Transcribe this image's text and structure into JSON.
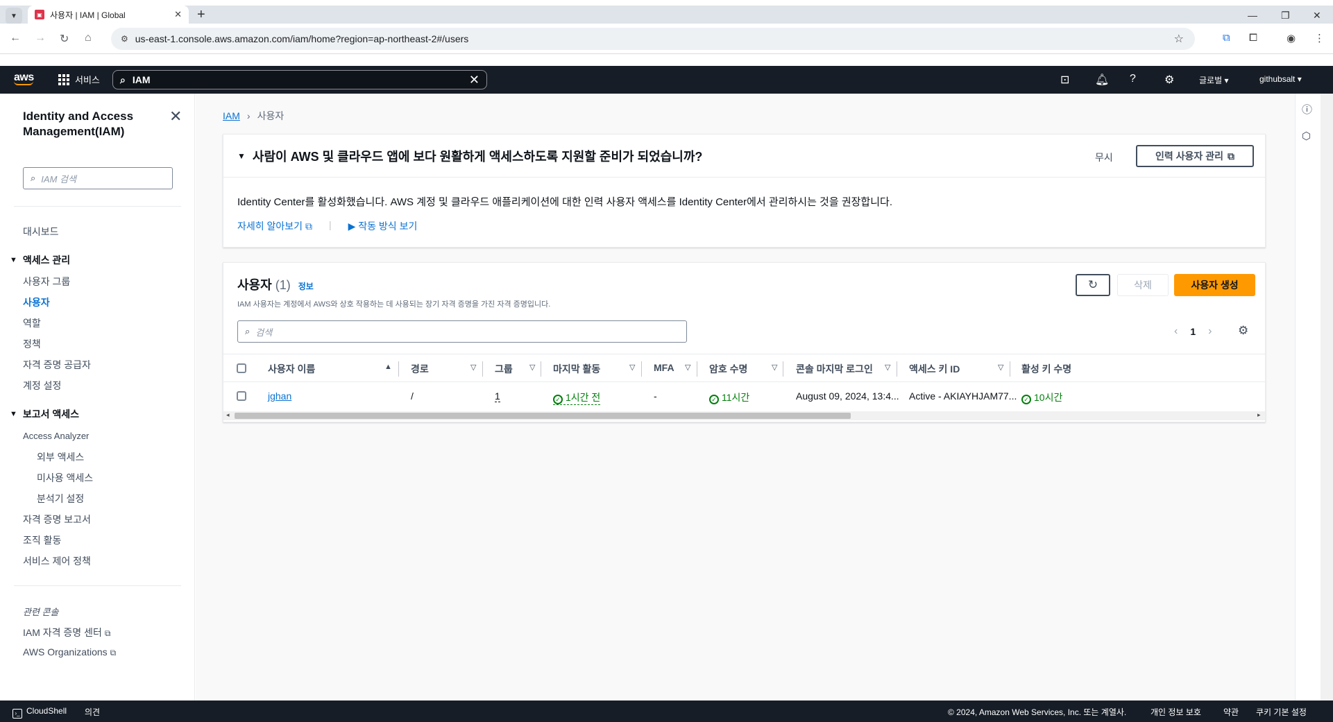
{
  "browser": {
    "tab_title": "사용자 | IAM | Global",
    "url": "us-east-1.console.aws.amazon.com/iam/home?region=ap-northeast-2#/users"
  },
  "topnav": {
    "logo": "aws",
    "services": "서비스",
    "search_value": "IAM",
    "region": "글로벌 ▾",
    "account": "githubsalt ▾"
  },
  "sidebar": {
    "title": "Identity and Access Management(IAM)",
    "search_placeholder": "IAM 검색",
    "dashboard": "대시보드",
    "access_mgmt": "액세스 관리",
    "items": [
      "사용자 그룹",
      "사용자",
      "역할",
      "정책",
      "자격 증명 공급자",
      "계정 설정"
    ],
    "report_access": "보고서 액세스",
    "access_analyzer": "Access Analyzer",
    "analyzer_items": [
      "외부 액세스",
      "미사용 액세스",
      "분석기 설정"
    ],
    "report_items": [
      "자격 증명 보고서",
      "조직 활동",
      "서비스 제어 정책"
    ],
    "related": "관련 콘솔",
    "related_items": [
      "IAM 자격 증명 센터",
      "AWS Organizations"
    ]
  },
  "breadcrumb": {
    "root": "IAM",
    "current": "사용자"
  },
  "banner": {
    "title": "사람이 AWS 및 클라우드 앱에 보다 원활하게 액세스하도록 지원할 준비가 되었습니까?",
    "dismiss": "무시",
    "manage_btn": "인력 사용자 관리",
    "text": "Identity Center를 활성화했습니다. AWS 계정 및 클라우드 애플리케이션에 대한 인력 사용자 액세스를 Identity Center에서 관리하시는 것을 권장합니다.",
    "learn_more": "자세히 알아보기",
    "how_it_works": "작동 방식 보기"
  },
  "users": {
    "title": "사용자",
    "count": "(1)",
    "info": "정보",
    "description": "IAM 사용자는 계정에서 AWS와 상호 작용하는 데 사용되는 장기 자격 증명을 가진 자격 증명입니다.",
    "delete_btn": "삭제",
    "create_btn": "사용자 생성",
    "search_placeholder": "검색",
    "page": "1",
    "columns": [
      "사용자 이름",
      "경로",
      "그룹",
      "마지막 활동",
      "MFA",
      "암호 수명",
      "콘솔 마지막 로그인",
      "액세스 키 ID",
      "활성 키 수명"
    ],
    "rows": [
      {
        "name": "jghan",
        "path": "/",
        "groups": "1",
        "last_activity": "1시간 전",
        "mfa": "-",
        "password_age": "11시간",
        "console_last_login": "August 09, 2024, 13:4...",
        "access_key_id": "Active - AKIAYHJAM77...",
        "active_key_age": "10시간"
      }
    ]
  },
  "footer": {
    "cloudshell": "CloudShell",
    "feedback": "의견",
    "copyright": "© 2024, Amazon Web Services, Inc. 또는 계열사.",
    "privacy": "개인 정보 보호",
    "terms": "약관",
    "cookies": "쿠키 기본 설정"
  },
  "colors": {
    "nav_bg": "#161d26",
    "accent_orange": "#ff9900",
    "link_blue": "#0972d3",
    "success_green": "#037f0c"
  }
}
